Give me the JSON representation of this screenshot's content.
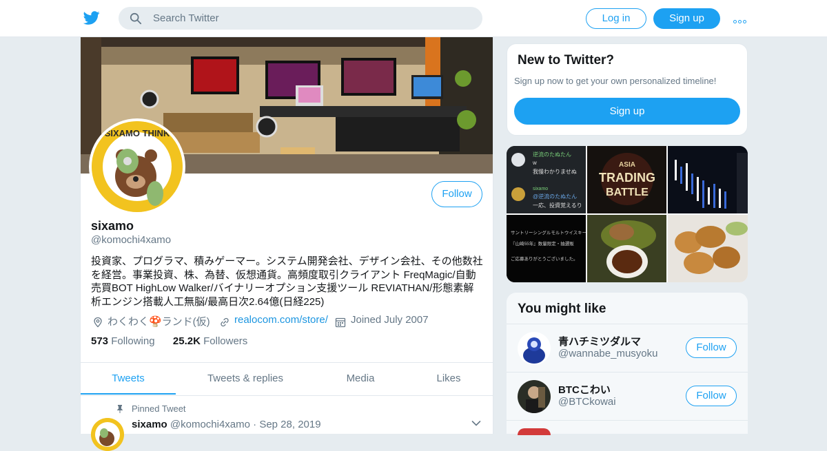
{
  "header": {
    "logo_icon": "twitter-bird-icon",
    "search_placeholder": "Search Twitter",
    "login_label": "Log in",
    "signup_label": "Sign up",
    "more_icon": "more-dots-icon"
  },
  "profile": {
    "name": "sixamo",
    "handle": "@komochi4xamo",
    "follow_label": "Follow",
    "bio": "投資家、プログラマ、積みゲーマー。システム開発会社、デザイン会社、その他数社を経営。事業投資、株、為替、仮想通貨。高頻度取引クライアント FreqMagic/自動売買BOT HighLow Walker/バイナリーオプション支援ツール REVIATHAN/形態素解析エンジン搭載人工無脳/最高日次2.64億(日経225)",
    "avatar_text": "SIXAMO THINK",
    "location": "わくわく🍄ランド(仮)",
    "url": "realocom.com/store/",
    "joined": "Joined July 2007",
    "following_count": "573",
    "following_label": "Following",
    "followers_count": "25.2K",
    "followers_label": "Followers"
  },
  "tabs": [
    "Tweets",
    "Tweets & replies",
    "Media",
    "Likes"
  ],
  "pinned_tweet": {
    "label": "Pinned Tweet",
    "name": "sixamo",
    "handle": "@komochi4xamo",
    "separator": "·",
    "date": "Sep 28, 2019"
  },
  "new_to_twitter": {
    "title": "New to Twitter?",
    "subtitle": "Sign up now to get your own personalized timeline!",
    "button": "Sign up"
  },
  "media_tiles": {
    "t1_name": "逆流のたぬたん",
    "t1_line1": "w",
    "t1_line2": "我慢わかりませぬ",
    "t1_name2": "sixamo",
    "t1_reply": "@逆流のたぬたん",
    "t1_line3": "一応、投資覚えるり",
    "t2_top": "ASIA",
    "t2_main": "TRADING",
    "t2_sub": "BATTLE",
    "t4_line1": "サントリーシングルモルトウイスキー",
    "t4_line2": "『山崎55年』数量限定・抽選販",
    "t4_line3": "ご応募ありがとうございました。"
  },
  "you_might_like": {
    "title": "You might like",
    "follow_label": "Follow",
    "users": [
      {
        "name": "青ハチミツダルマ",
        "handle": "@wannabe_musyoku"
      },
      {
        "name": "BTCこわい",
        "handle": "@BTCkowai"
      }
    ]
  }
}
